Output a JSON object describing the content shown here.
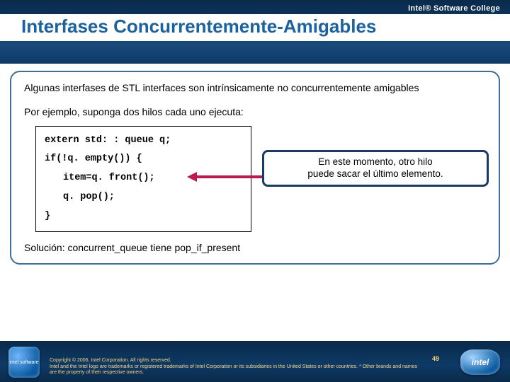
{
  "brand": "Intel® Software College",
  "title": "Interfases Concurrentemente-Amigables",
  "para1": "Algunas interfases de STL interfaces son intrínsicamente no concurrentemente amigables",
  "para2": "Por ejemplo, suponga dos hilos cada uno ejecuta:",
  "code": {
    "l1": "extern std: : queue q;",
    "l2": "if(!q. empty()) {",
    "l3": "item=q. front();",
    "l4": "q. pop();",
    "l5": "}"
  },
  "callout": {
    "l1": "En este momento, otro hilo",
    "l2": "puede sacar el último elemento."
  },
  "solution_label": "Solución:",
  "solution_text": "concurrent_queue tiene pop_if_present",
  "footer": {
    "copyright": "Copyright © 2006, Intel Corporation. All rights reserved.",
    "legal": "Intel and the Intel logo are trademarks or registered trademarks of Intel Corporation or its subsidiaries in the United States or other countries. * Other brands and names are the property of their respective owners.",
    "page": "49",
    "left_logo": "intel software",
    "right_logo": "intel"
  }
}
